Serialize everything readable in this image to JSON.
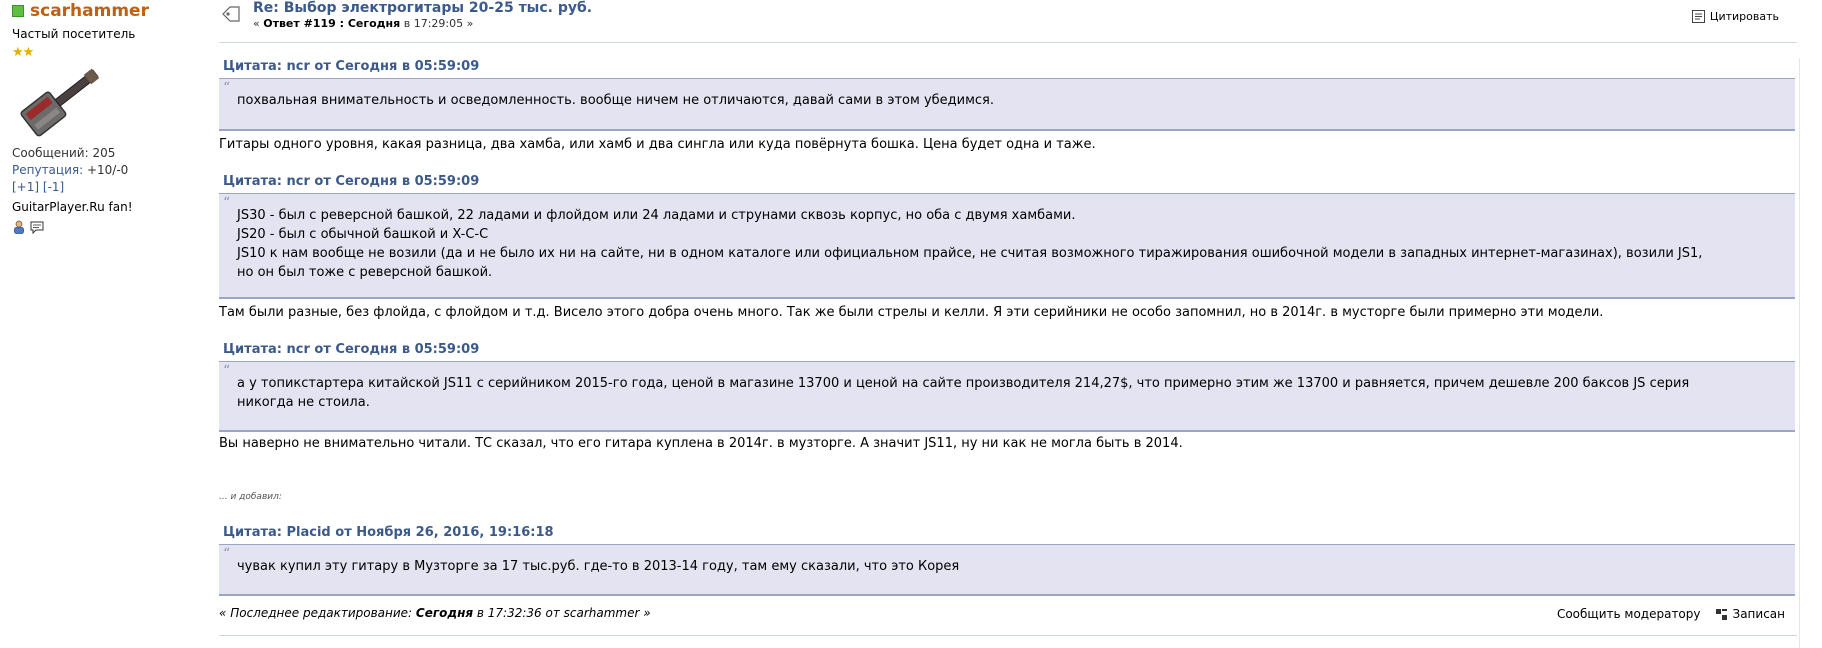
{
  "poster": {
    "username": "scarhammer",
    "rank": "Частый посетитель",
    "stars": "★★",
    "posts_label": "Сообщений:",
    "posts_value": "205",
    "rep_label": "Репутация:",
    "rep_value": "+10/-0",
    "rep_plus": "[+1]",
    "rep_minus": "[-1]",
    "signature": "GuitarPlayer.Ru fan!"
  },
  "post": {
    "subject": "Re: Выбор электрогитары 20-25 тыс. руб.",
    "reply_prefix": "« ",
    "reply_num": "Ответ #119 : Сегодня",
    "reply_in": " в 17:29:05 »",
    "quote_button": "Цитировать",
    "quotes": [
      {
        "header": "Цитата: ncr от Сегодня в 05:59:09",
        "lines": [
          "похвальная внимательность и осведомленность. вообще ничем не отличаются, давай сами в этом убедимся."
        ]
      },
      {
        "header": "Цитата: ncr от Сегодня в 05:59:09",
        "lines": [
          "JS30 - был с реверсной башкой, 22 ладами и флойдом или 24 ладами и струнами сквозь корпус, но оба с двумя хамбами.",
          "JS20 - был с обычной башкой и X-C-C",
          "JS10 к нам вообще не возили (да и не было их ни на сайте, ни в одном каталоге или официальном прайсе, не считая возможного тиражирования ошибочной модели в западных интернет-магазинах), возили JS1,",
          "но он был тоже с реверсной башкой."
        ]
      },
      {
        "header": "Цитата: ncr от Сегодня в 05:59:09",
        "lines": [
          "а у топикстартера китайской JS11 с серийником 2015-го года, ценой в магазине 13700 и ценой на сайте производителя 214,27$, что примерно этим же 13700 и равняется, причем дешевле 200 баксов JS серия",
          "никогда не стоила."
        ]
      },
      {
        "header": "Цитата: Placid от Ноября 26, 2016, 19:16:18",
        "lines": [
          "чувак купил эту гитару в Музторге за 17 тыс.руб. где-то в 2013-14 году, там ему сказали, что это Корея"
        ]
      }
    ],
    "replies": [
      "Гитары одного уровня, какая разница, два хамба, или хамб и два сингла или куда повёрнута бошка. Цена будет одна и таже.",
      "Там были разные, без флойда, с флойдом и т.д. Висело этого добра очень много. Так же были стрелы и келли. Я эти серийники не особо запомнил, но в 2014г. в мусторге были примерно эти модели.",
      "Вы наверно не внимательно читали. ТС сказал, что его гитара куплена в 2014г. в музторге. А значит JS11, ну ни как не могла быть в 2014."
    ],
    "added_label": "... и добавил:",
    "edit_prefix": "« Последнее редактирование: ",
    "edit_when": "Сегодня",
    "edit_suffix": " в 17:32:36 от scarhammer »",
    "report_link": "Сообщить модератору",
    "logged_label": "Записан"
  }
}
